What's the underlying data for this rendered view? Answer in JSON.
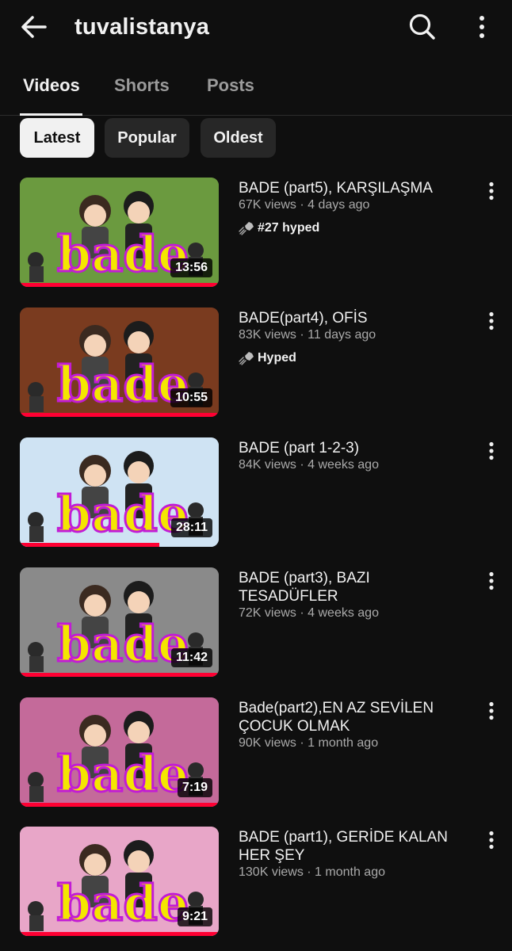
{
  "header": {
    "channel_name": "tuvalistanya"
  },
  "tabs": [
    {
      "label": "Videos",
      "active": true
    },
    {
      "label": "Shorts",
      "active": false
    },
    {
      "label": "Posts",
      "active": false
    }
  ],
  "filters": [
    {
      "label": "Latest",
      "selected": true
    },
    {
      "label": "Popular",
      "selected": false
    },
    {
      "label": "Oldest",
      "selected": false
    }
  ],
  "videos": [
    {
      "title": "BADE (part5), KARŞILAŞMA",
      "stats": "67K views · 4 days ago",
      "hype": "#27 hyped",
      "duration": "13:56",
      "thumb_text": "bade",
      "thumb_bg": "#6b9a3f",
      "watched": 1.0
    },
    {
      "title": "BADE(part4), OFİS",
      "stats": "83K views · 11 days ago",
      "hype": "Hyped",
      "duration": "10:55",
      "thumb_text": "bade",
      "thumb_bg": "#7a3b1f",
      "watched": 1.0
    },
    {
      "title": "BADE (part 1-2-3)",
      "stats": "84K views · 4 weeks ago",
      "hype": "",
      "duration": "28:11",
      "thumb_text": "bade",
      "thumb_bg": "#cfe3f3",
      "watched": 0.7
    },
    {
      "title": "BADE (part3), BAZI TESADÜFLER",
      "stats": "72K views · 4 weeks ago",
      "hype": "",
      "duration": "11:42",
      "thumb_text": "bade",
      "thumb_bg": "#8a8a8a",
      "watched": 1.0
    },
    {
      "title": "Bade(part2),EN AZ SEVİLEN ÇOCUK OLMAK",
      "stats": "90K views · 1 month ago",
      "hype": "",
      "duration": "7:19",
      "thumb_text": "bade",
      "thumb_bg": "#c46a9a",
      "watched": 1.0
    },
    {
      "title": "BADE (part1), GERİDE KALAN HER ŞEY",
      "stats": "130K views · 1 month ago",
      "hype": "",
      "duration": "9:21",
      "thumb_text": "bade",
      "thumb_bg": "#e8a6c8",
      "watched": 1.0
    }
  ],
  "colors": {
    "background": "#0f0f0f",
    "progress": "#ff0033",
    "thumb_text_fill": "#f4e600",
    "thumb_text_stroke": "#c21bd6"
  },
  "icons": {
    "back": "arrow-left-icon",
    "search": "search-icon",
    "more": "more-vert-icon",
    "hype": "hype-icon"
  }
}
